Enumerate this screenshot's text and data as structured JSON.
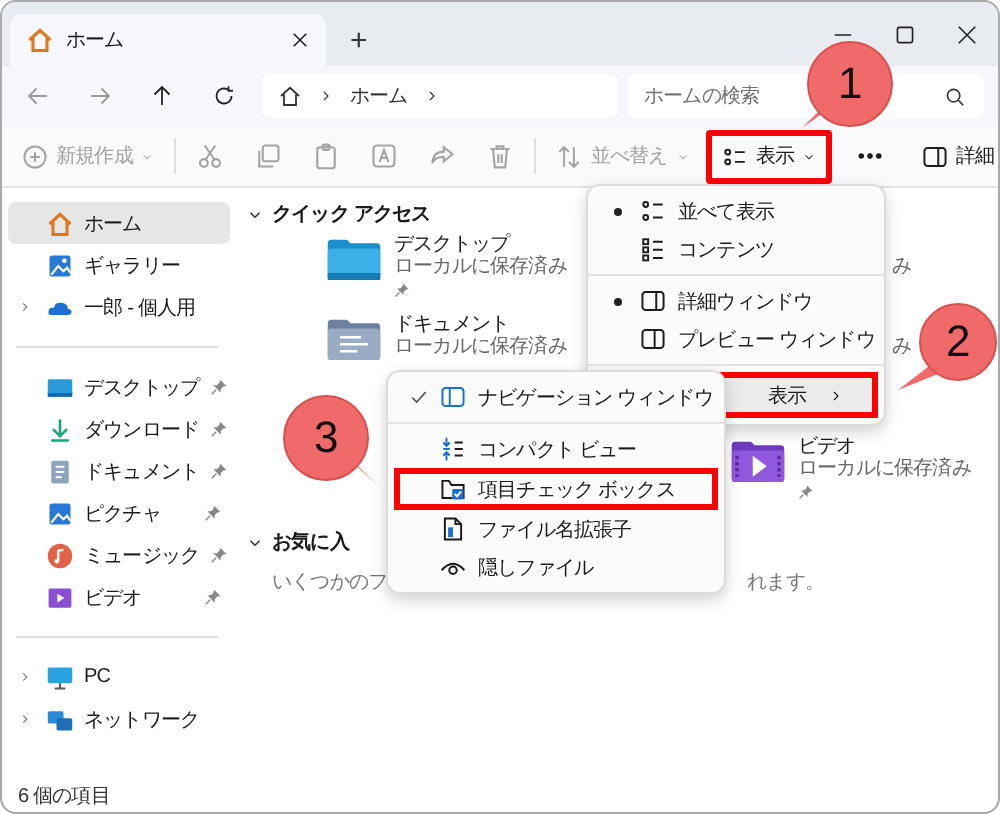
{
  "tab": {
    "title": "ホーム",
    "selected": true
  },
  "new_tab": "+",
  "address": {
    "segments": [
      "ホーム"
    ]
  },
  "search": {
    "placeholder": "ホームの検索"
  },
  "toolbar": [
    {
      "kind": "new",
      "label": "新規作成",
      "disabled": true,
      "highlighted": false
    },
    {
      "kind": "divider"
    },
    {
      "kind": "cut",
      "disabled": true,
      "highlighted": false
    },
    {
      "kind": "copy",
      "disabled": true,
      "highlighted": false
    },
    {
      "kind": "paste",
      "disabled": true,
      "highlighted": false
    },
    {
      "kind": "rename",
      "disabled": true,
      "highlighted": false
    },
    {
      "kind": "share",
      "disabled": true,
      "highlighted": false
    },
    {
      "kind": "delete",
      "disabled": true,
      "highlighted": false
    },
    {
      "kind": "divider"
    },
    {
      "kind": "sort",
      "label": "並べ替え",
      "disabled": true,
      "highlighted": false
    },
    {
      "kind": "view",
      "label": "表示",
      "disabled": false,
      "highlighted": true
    },
    {
      "kind": "more",
      "disabled": false,
      "highlighted": false
    },
    {
      "kind": "details",
      "label": "詳細",
      "disabled": false,
      "highlighted": false
    }
  ],
  "sidebar": {
    "groups": [
      {
        "items": [
          {
            "kind": "home",
            "label": "ホーム",
            "selected": true,
            "expandable": false,
            "pinned": false
          },
          {
            "kind": "gallery",
            "label": "ギャラリー",
            "selected": false,
            "expandable": false,
            "pinned": false
          },
          {
            "kind": "cloud",
            "label": "一郎 - 個人用",
            "selected": false,
            "expandable": true,
            "pinned": false
          }
        ]
      },
      {
        "items": [
          {
            "kind": "desktop",
            "label": "デスクトップ",
            "selected": false,
            "expandable": false,
            "pinned": true
          },
          {
            "kind": "download",
            "label": "ダウンロード",
            "selected": false,
            "expandable": false,
            "pinned": true
          },
          {
            "kind": "documents",
            "label": "ドキュメント",
            "selected": false,
            "expandable": false,
            "pinned": true
          },
          {
            "kind": "pictures",
            "label": "ピクチャ",
            "selected": false,
            "expandable": false,
            "pinned": true
          },
          {
            "kind": "music",
            "label": "ミュージック",
            "selected": false,
            "expandable": false,
            "pinned": true
          },
          {
            "kind": "videos",
            "label": "ビデオ",
            "selected": false,
            "expandable": false,
            "pinned": true
          }
        ]
      },
      {
        "items": [
          {
            "kind": "pc",
            "label": "PC",
            "selected": false,
            "expandable": true,
            "pinned": false
          },
          {
            "kind": "network",
            "label": "ネットワーク",
            "selected": false,
            "expandable": true,
            "pinned": false
          }
        ]
      }
    ]
  },
  "sections": [
    {
      "kind": "grid",
      "title": "クイック アクセス",
      "expanded": true,
      "items": [
        {
          "kind": "desktop",
          "name": "デスクトップ",
          "sub": "ローカルに保存済み",
          "pinned": true
        },
        {
          "kind": "fragment",
          "text": "み"
        },
        {
          "kind": "documents",
          "name": "ドキュメント",
          "sub": "ローカルに保存済み",
          "pinned": false
        },
        {
          "kind": "fragment",
          "text": "み"
        },
        {
          "kind": "covered"
        },
        {
          "kind": "videos",
          "name": "ビデオ",
          "sub": "ローカルに保存済み",
          "pinned": true
        }
      ]
    },
    {
      "kind": "text",
      "title": "お気に入",
      "expanded": true,
      "text_parts": [
        "いくつかのフ",
        "れます。"
      ]
    }
  ],
  "menu": {
    "items": [
      {
        "kind": "tiles",
        "label": "並べて表示",
        "selected": true
      },
      {
        "kind": "content",
        "label": "コンテンツ",
        "selected": false
      },
      {
        "kind": "separator"
      },
      {
        "kind": "details-pane",
        "label": "詳細ウィンドウ",
        "selected": true
      },
      {
        "kind": "preview-pane",
        "label": "プレビュー ウィンドウ",
        "selected": false
      },
      {
        "kind": "separator"
      },
      {
        "kind": "submenu",
        "label": "表示",
        "hovered": true,
        "highlighted": true
      }
    ]
  },
  "submenu": {
    "items": [
      {
        "kind": "nav-pane",
        "label": "ナビゲーション ウィンドウ",
        "checked": true,
        "highlighted": false
      },
      {
        "kind": "separator"
      },
      {
        "kind": "compact",
        "label": "コンパクト ビュー",
        "checked": false,
        "highlighted": false
      },
      {
        "kind": "item-checkbox",
        "label": "項目チェック ボックス",
        "checked": false,
        "highlighted": true
      },
      {
        "kind": "file",
        "label": "ファイル名拡張子",
        "checked": false,
        "highlighted": false
      },
      {
        "kind": "eye",
        "label": "隠しファイル",
        "checked": false,
        "highlighted": false
      }
    ]
  },
  "callouts": [
    {
      "number": "1"
    },
    {
      "number": "2"
    },
    {
      "number": "3"
    }
  ],
  "status_bar": "6 個の項目"
}
